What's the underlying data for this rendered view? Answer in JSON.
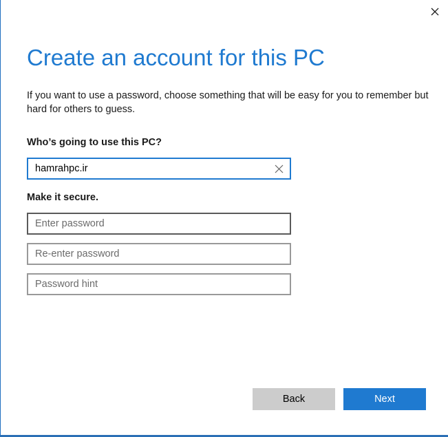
{
  "dialog": {
    "title": "Create an account for this PC",
    "description": "If you want to use a password, choose something that will be easy for you to remember but hard for others to guess."
  },
  "user_section": {
    "label": "Who’s going to use this PC?",
    "username_value": "hamrahpc.ir"
  },
  "password_section": {
    "label": "Make it secure.",
    "password_placeholder": "Enter password",
    "reenter_placeholder": "Re-enter password",
    "hint_placeholder": "Password hint"
  },
  "buttons": {
    "back_label": "Back",
    "next_label": "Next"
  },
  "icons": {
    "close": "close-icon",
    "clear": "clear-text-icon"
  },
  "colors": {
    "accent": "#1f7ad0",
    "text": "#1a1a1a",
    "field_border": "#999999",
    "back_button": "#cccccc"
  }
}
